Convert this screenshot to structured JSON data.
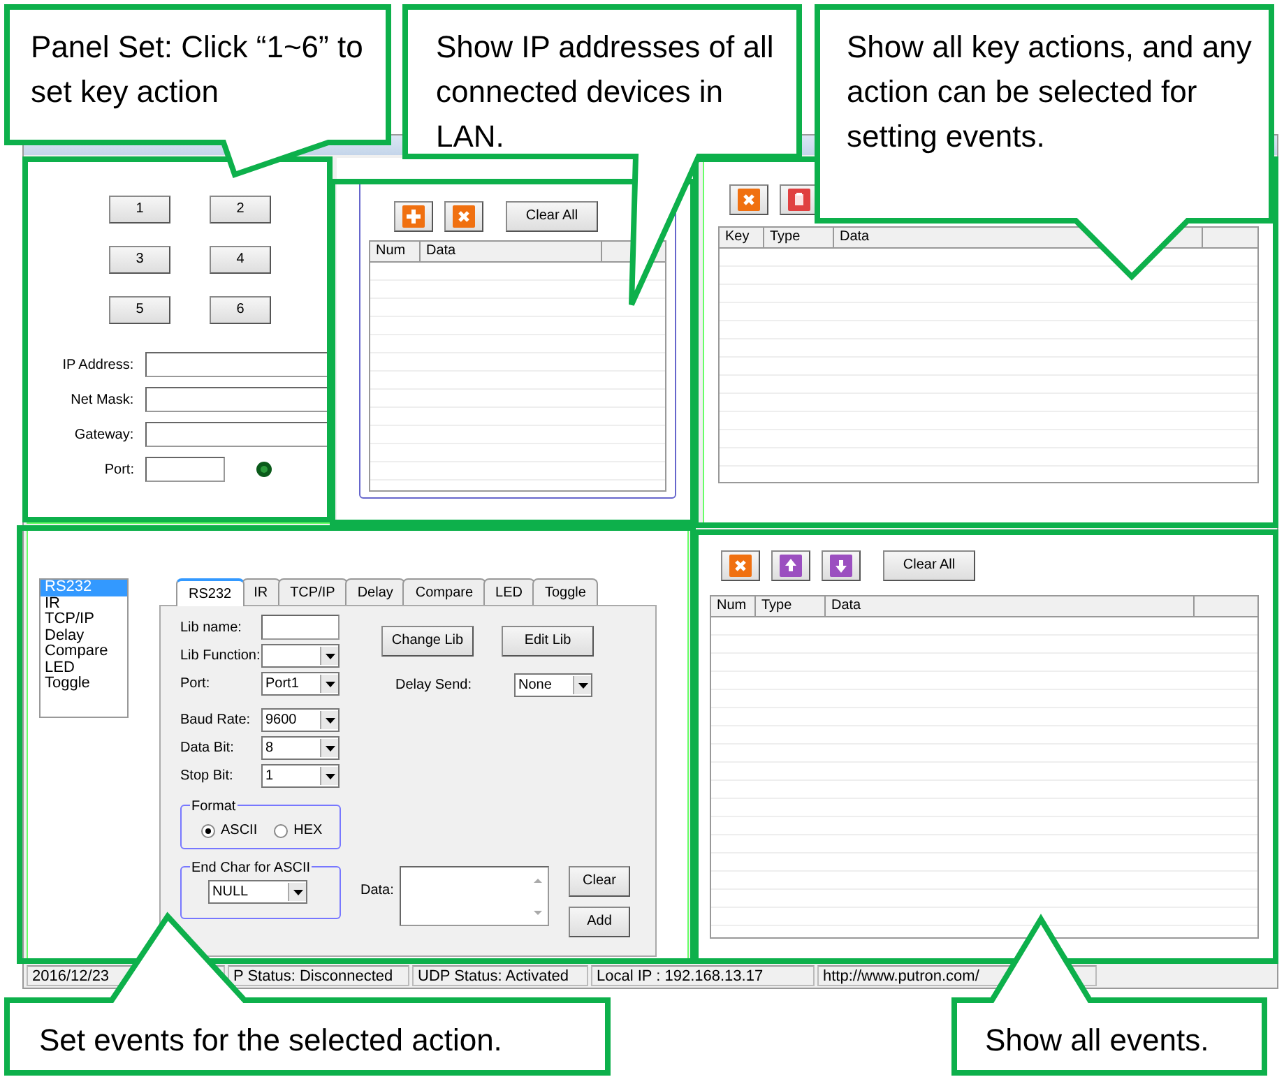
{
  "panel_set": {
    "keys": [
      "1",
      "2",
      "3",
      "4",
      "5",
      "6"
    ],
    "fields": [
      {
        "label": "IP Address:",
        "kind": "ip"
      },
      {
        "label": "Net Mask:",
        "kind": "ip"
      },
      {
        "label": "Gateway:",
        "kind": "ip"
      },
      {
        "label": "Port:",
        "kind": "port"
      }
    ]
  },
  "tcp_ip": {
    "buttons": [
      {
        "kind": "add"
      },
      {
        "kind": "delete"
      },
      {
        "kind": "text",
        "label": "Clear All"
      }
    ],
    "columns": [
      "Num",
      "Data"
    ]
  },
  "key_actions": {
    "buttons": [
      {
        "kind": "delete"
      },
      {
        "kind": "clear"
      }
    ],
    "columns": [
      "Key",
      "Type",
      "Data"
    ]
  },
  "event_set": {
    "types": [
      {
        "label": "RS232",
        "selected": true
      },
      {
        "label": "IR",
        "selected": false
      },
      {
        "label": "TCP/IP",
        "selected": false
      },
      {
        "label": "Delay",
        "selected": false
      },
      {
        "label": "Compare",
        "selected": false
      },
      {
        "label": "LED",
        "selected": false
      },
      {
        "label": "Toggle",
        "selected": false
      }
    ],
    "tabs": [
      {
        "label": "RS232",
        "selected": true
      },
      {
        "label": "IR",
        "selected": false
      },
      {
        "label": "TCP/IP",
        "selected": false
      },
      {
        "label": "Delay",
        "selected": false
      },
      {
        "label": "Compare",
        "selected": false
      },
      {
        "label": "LED",
        "selected": false
      },
      {
        "label": "Toggle",
        "selected": false
      }
    ],
    "rows": [
      {
        "label": "Lib name:",
        "kind": "text"
      },
      {
        "label": "Lib Function:",
        "kind": "select"
      },
      {
        "label": "Port:",
        "kind": "select",
        "value": "Port1"
      },
      {
        "label": "Baud Rate:",
        "kind": "select",
        "value": "9600"
      },
      {
        "label": "Data Bit:",
        "kind": "select",
        "value": "8"
      },
      {
        "label": "Stop Bit:",
        "kind": "select",
        "value": "1"
      }
    ],
    "lib_buttons": [
      "Change Lib",
      "Edit Lib"
    ],
    "delay_send": {
      "label": "Delay Send:",
      "value": "None"
    },
    "format": {
      "title": "Format",
      "options": [
        {
          "label": "ASCII",
          "selected": true
        },
        {
          "label": "HEX",
          "selected": false
        }
      ]
    },
    "end_char": {
      "title": "End Char for ASCII",
      "value": "NULL"
    },
    "data": {
      "label": "Data:"
    },
    "actions": [
      "Clear",
      "Add"
    ]
  },
  "event_list": {
    "buttons": [
      {
        "kind": "delete"
      },
      {
        "kind": "up"
      },
      {
        "kind": "down"
      },
      {
        "kind": "text",
        "label": "Clear All"
      }
    ],
    "columns": [
      "Num",
      "Type",
      "Data"
    ]
  },
  "status_bar": [
    "2016/12/23",
    "P Status: Disconnected",
    "UDP Status: Activated",
    "Local IP : 192.168.13.17",
    "http://www.putron.com/"
  ],
  "callouts": [
    {
      "text": "Panel Set: Click “1~6” to set key action"
    },
    {
      "text": "Show IP addresses of all connected devices in LAN."
    },
    {
      "text": "Show all key actions, and any action can be selected for setting events."
    },
    {
      "text": "Set events for the selected action."
    },
    {
      "text": "Show all events."
    }
  ]
}
